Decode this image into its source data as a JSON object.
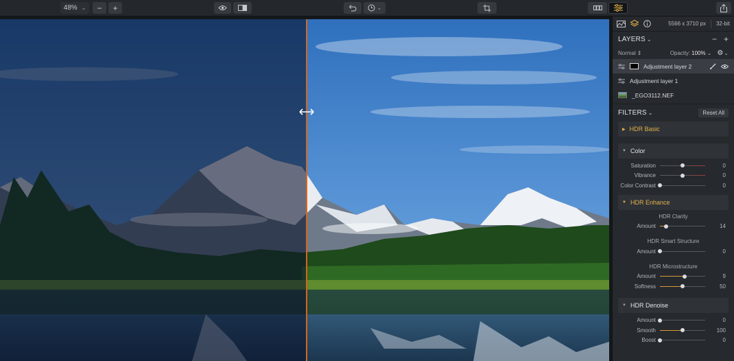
{
  "toolbar": {
    "zoom": "48%",
    "zoom_out": "−",
    "zoom_in": "+"
  },
  "info": {
    "resolution": "5566 x 3710 px",
    "bitdepth": "32-bit"
  },
  "layers": {
    "title": "LAYERS",
    "add": "+",
    "remove": "−",
    "blend_mode": "Normal",
    "opacity_label": "Opacity:",
    "opacity_value": "100%",
    "items": [
      {
        "label": "Adjustment layer 2",
        "selected": true
      },
      {
        "label": "Adjustment layer 1",
        "selected": false
      },
      {
        "label": "_EGO3112.NEF",
        "selected": false
      }
    ]
  },
  "filters": {
    "title": "FILTERS",
    "reset_all": "Reset All",
    "hdr_basic": "HDR Basic",
    "color": {
      "title": "Color",
      "sliders": [
        {
          "label": "Saturation",
          "value": "0",
          "pos": 0.5
        },
        {
          "label": "Vibrance",
          "value": "0",
          "pos": 0.5
        },
        {
          "label": "Color Contrast",
          "value": "0",
          "pos": 0.0
        }
      ]
    },
    "hdr_enhance": {
      "title": "HDR Enhance",
      "clarity_title": "HDR Clarity",
      "clarity_amount": {
        "label": "Amount",
        "value": "14",
        "pos": 0.14
      },
      "smart_title": "HDR Smart Structure",
      "smart_amount": {
        "label": "Amount",
        "value": "0",
        "pos": 0.0
      },
      "micro_title": "HDR Microstructure",
      "micro_amount": {
        "label": "Amount",
        "value": "9",
        "pos": 0.54
      },
      "micro_softness": {
        "label": "Softness",
        "value": "50",
        "pos": 0.5
      }
    },
    "hdr_denoise": {
      "title": "HDR Denoise",
      "amount": {
        "label": "Amount",
        "value": "0",
        "pos": 0.0
      },
      "smooth": {
        "label": "Smooth",
        "value": "100",
        "pos": 0.5
      },
      "boost": {
        "label": "Boost",
        "value": "0",
        "pos": 0.0
      }
    }
  },
  "colors": {
    "accent": "#e4b24a",
    "split_line": "#d8661a",
    "panel_bg": "#26292d",
    "toolbar_bg": "#24272b"
  }
}
